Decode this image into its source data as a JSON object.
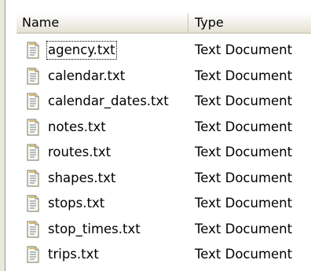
{
  "columns": {
    "name": "Name",
    "type": "Type"
  },
  "files": [
    {
      "name": "agency.txt",
      "type": "Text Document"
    },
    {
      "name": "calendar.txt",
      "type": "Text Document"
    },
    {
      "name": "calendar_dates.txt",
      "type": "Text Document"
    },
    {
      "name": "notes.txt",
      "type": "Text Document"
    },
    {
      "name": "routes.txt",
      "type": "Text Document"
    },
    {
      "name": "shapes.txt",
      "type": "Text Document"
    },
    {
      "name": "stops.txt",
      "type": "Text Document"
    },
    {
      "name": "stop_times.txt",
      "type": "Text Document"
    },
    {
      "name": "trips.txt",
      "type": "Text Document"
    }
  ],
  "icons": {
    "file": "text-file-icon"
  }
}
